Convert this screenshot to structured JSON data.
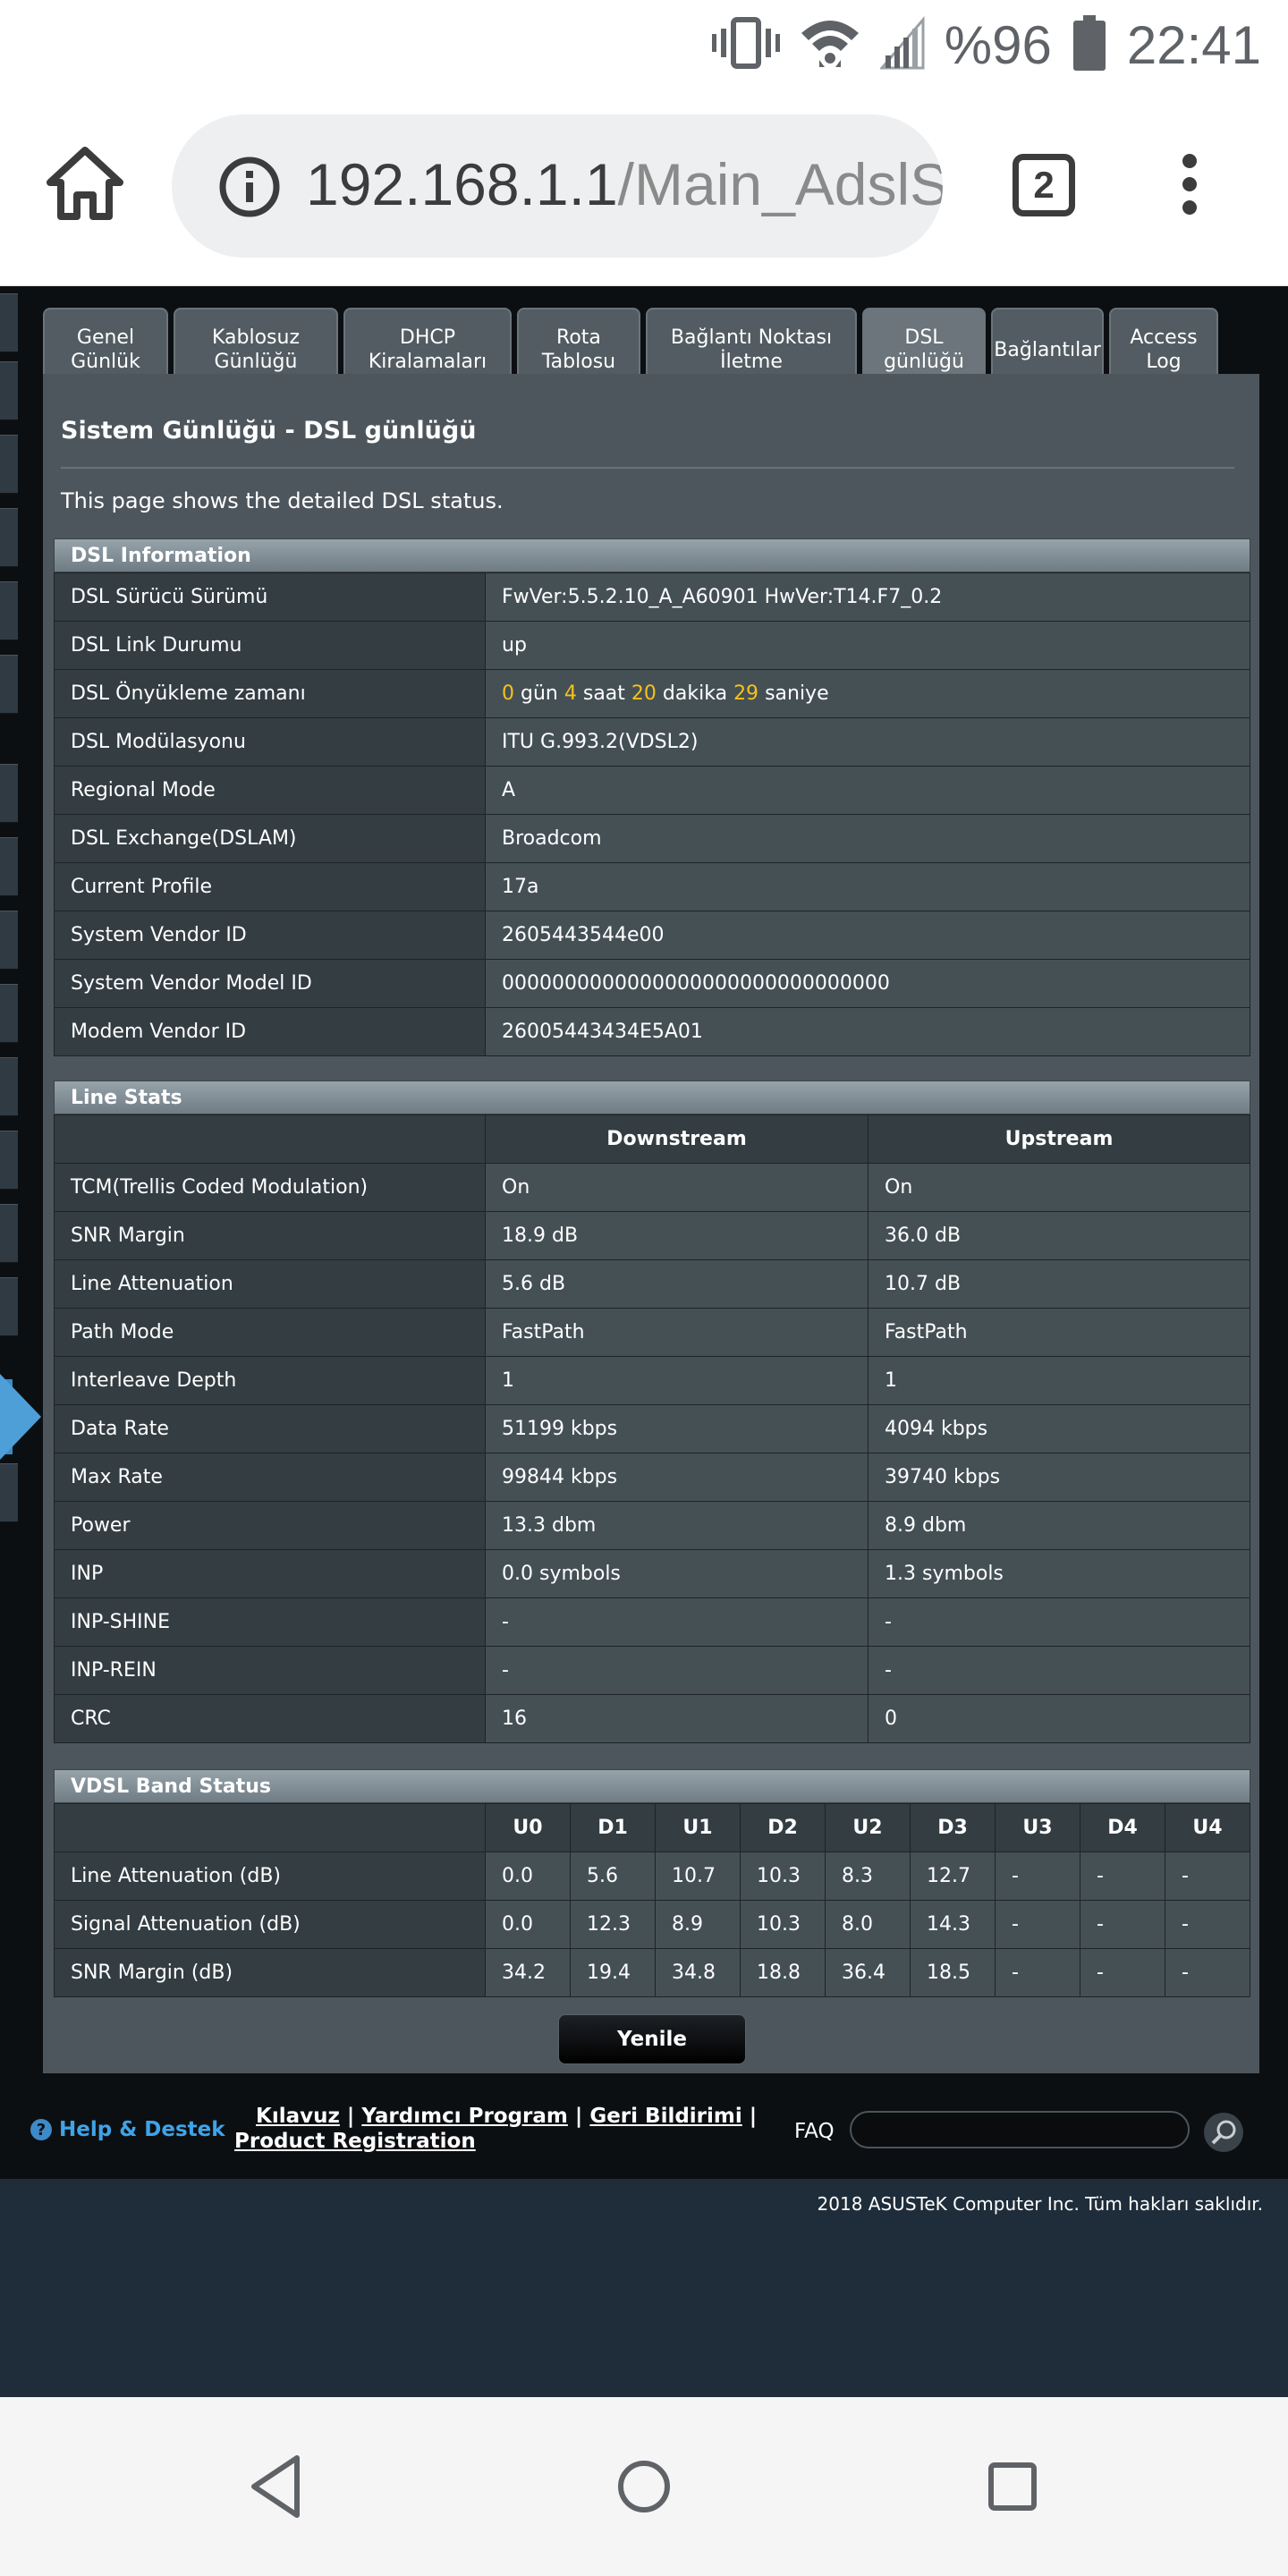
{
  "status_bar": {
    "battery_percent": "%96",
    "time": "22:41",
    "icons": [
      "vibrate-icon",
      "wifi-icon",
      "signal-icon",
      "battery-icon"
    ]
  },
  "browser": {
    "url_host": "192.168.1.1",
    "url_path": "/Main_AdslS",
    "tab_count": "2",
    "icons": [
      "home-icon",
      "info-icon",
      "tabs-icon",
      "more-vert-icon"
    ]
  },
  "tabs": [
    {
      "label": "Genel\nGünlük"
    },
    {
      "label": "Kablosuz\nGünlüğü"
    },
    {
      "label": "DHCP\nKiralamaları"
    },
    {
      "label": "Rota\nTablosu"
    },
    {
      "label": "Bağlantı Noktası\nİletme"
    },
    {
      "label": "DSL\ngünlüğü"
    },
    {
      "label": "Bağlantılar"
    },
    {
      "label": "Access\nLog"
    }
  ],
  "panel": {
    "title": "Sistem Günlüğü - DSL günlüğü",
    "description": "This page shows the detailed DSL status."
  },
  "dsl_info": {
    "header": "DSL Information",
    "rows": [
      {
        "label": "DSL Sürücü Sürümü",
        "value": "FwVer:5.5.2.10_A_A60901 HwVer:T14.F7_0.2"
      },
      {
        "label": "DSL Link Durumu",
        "value": "up"
      },
      {
        "label": "DSL Önyükleme zamanı",
        "uptime": {
          "days": "0",
          "days_label": "gün",
          "hours": "4",
          "hours_label": "saat",
          "minutes": "20",
          "minutes_label": "dakika",
          "seconds": "29",
          "seconds_label": "saniye"
        }
      },
      {
        "label": "DSL Modülasyonu",
        "value": "ITU G.993.2(VDSL2)"
      },
      {
        "label": "Regional Mode",
        "value": "A"
      },
      {
        "label": "DSL Exchange(DSLAM)",
        "value": "Broadcom"
      },
      {
        "label": "Current Profile",
        "value": "17a"
      },
      {
        "label": "System Vendor ID",
        "value": "2605443544e00"
      },
      {
        "label": "System Vendor Model ID",
        "value": "0000000000000000000000000000000"
      },
      {
        "label": "Modem Vendor ID",
        "value": "26005443434E5A01"
      }
    ]
  },
  "line_stats": {
    "header": "Line Stats",
    "col_downstream": "Downstream",
    "col_upstream": "Upstream",
    "rows": [
      {
        "label": "TCM(Trellis Coded Modulation)",
        "down": "On",
        "up": "On"
      },
      {
        "label": "SNR Margin",
        "down": "18.9 dB",
        "up": "36.0 dB"
      },
      {
        "label": "Line Attenuation",
        "down": "5.6 dB",
        "up": "10.7 dB"
      },
      {
        "label": "Path Mode",
        "down": "FastPath",
        "up": "FastPath"
      },
      {
        "label": "Interleave Depth",
        "down": "1",
        "up": "1"
      },
      {
        "label": "Data Rate",
        "down": "51199 kbps",
        "up": "4094 kbps"
      },
      {
        "label": "Max Rate",
        "down": "99844 kbps",
        "up": "39740 kbps"
      },
      {
        "label": "Power",
        "down": "13.3 dbm",
        "up": "8.9 dbm"
      },
      {
        "label": "INP",
        "down": "0.0 symbols",
        "up": "1.3 symbols"
      },
      {
        "label": "INP-SHINE",
        "down": "-",
        "up": "-"
      },
      {
        "label": "INP-REIN",
        "down": "-",
        "up": "-"
      },
      {
        "label": "CRC",
        "down": "16",
        "up": "0"
      }
    ]
  },
  "vdsl_band": {
    "header": "VDSL Band Status",
    "columns": [
      "U0",
      "D1",
      "U1",
      "D2",
      "U2",
      "D3",
      "U3",
      "D4",
      "U4"
    ],
    "colors": {
      "upstream": "#3fb5e8",
      "downstream": "#f0961e"
    },
    "rows": [
      {
        "label": "Line Attenuation (dB)",
        "values": [
          "0.0",
          "5.6",
          "10.7",
          "10.3",
          "8.3",
          "12.7",
          "-",
          "-",
          "-"
        ]
      },
      {
        "label": "Signal Attenuation (dB)",
        "values": [
          "0.0",
          "12.3",
          "8.9",
          "10.3",
          "8.0",
          "14.3",
          "-",
          "-",
          "-"
        ]
      },
      {
        "label": "SNR Margin (dB)",
        "values": [
          "34.2",
          "19.4",
          "34.8",
          "18.8",
          "36.4",
          "18.5",
          "-",
          "-",
          "-"
        ]
      }
    ]
  },
  "refresh_button": "Yenile",
  "footer": {
    "help_label": "Help & Destek",
    "links": [
      "Kılavuz",
      "Yardımcı Program",
      "Geri Bildirimi",
      "Product Registration"
    ],
    "separator": "|",
    "faq_label": "FAQ",
    "faq_placeholder": "",
    "copyright": "2018 ASUSTeK Computer Inc. Tüm hakları saklıdır."
  }
}
